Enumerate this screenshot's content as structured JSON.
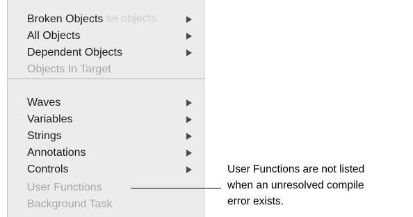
{
  "menu": {
    "ghost_text": "se objects",
    "items": [
      {
        "label": "Broken Objects",
        "submenu": true,
        "enabled": true
      },
      {
        "label": "All Objects",
        "submenu": true,
        "enabled": true
      },
      {
        "label": "Dependent Objects",
        "submenu": true,
        "enabled": true
      },
      {
        "label": "Objects In Target",
        "submenu": false,
        "enabled": false
      },
      {
        "label": "Waves",
        "submenu": true,
        "enabled": true
      },
      {
        "label": "Variables",
        "submenu": true,
        "enabled": true
      },
      {
        "label": "Strings",
        "submenu": true,
        "enabled": true
      },
      {
        "label": "Annotations",
        "submenu": true,
        "enabled": true
      },
      {
        "label": "Controls",
        "submenu": true,
        "enabled": true
      },
      {
        "label": "User Functions",
        "submenu": false,
        "enabled": false
      },
      {
        "label": "Background Task",
        "submenu": false,
        "enabled": false
      }
    ]
  },
  "callout": {
    "lines": [
      "User Functions are not listed",
      "when an unresolved compile",
      "error exists."
    ]
  },
  "icons": {
    "submenu_arrow": "triangle-right-icon"
  }
}
